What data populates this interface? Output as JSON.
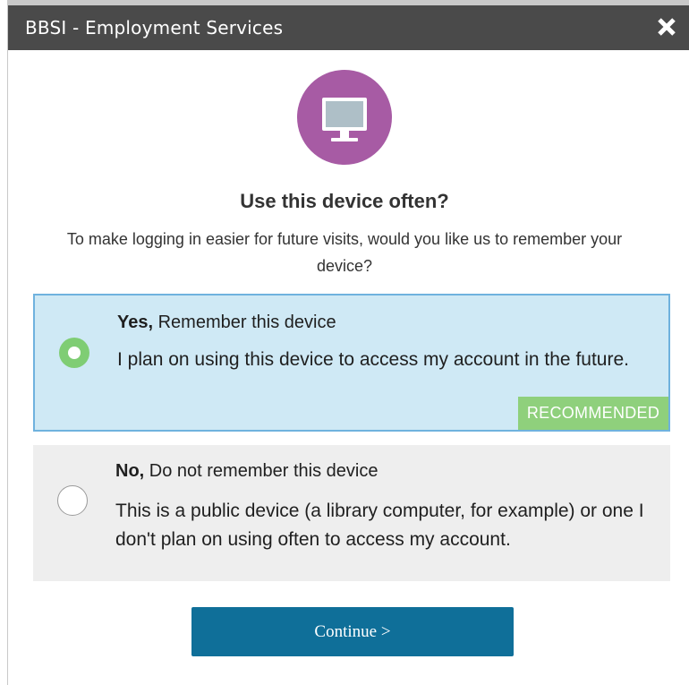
{
  "window": {
    "title": "BBSI - Employment Services",
    "close_icon": "close-icon"
  },
  "device_icon": {
    "name": "monitor-icon",
    "circle_color": "#a75ba4"
  },
  "heading": "Use this device often?",
  "subtext": "To make logging in easier for future visits, would you like us to remember your device?",
  "options": [
    {
      "selected": true,
      "title_bold": "Yes,",
      "title_rest": " Remember this device",
      "description": "I plan on using this device to access my account in the future.",
      "badge": "RECOMMENDED"
    },
    {
      "selected": false,
      "title_bold": "No,",
      "title_rest": " Do not remember this device",
      "description": "This is a public device (a library computer, for example) or one I don't plan on using often to access my account."
    }
  ],
  "continue_button": {
    "label": "Continue >"
  },
  "colors": {
    "titlebar": "#4a4a4a",
    "selected_option_bg": "#cfe9f5",
    "selected_option_border": "#6fb2de",
    "unselected_option_bg": "#eeeeee",
    "radio_selected": "#7fcd74",
    "badge": "#8fd07c",
    "button": "#0f6f99"
  }
}
